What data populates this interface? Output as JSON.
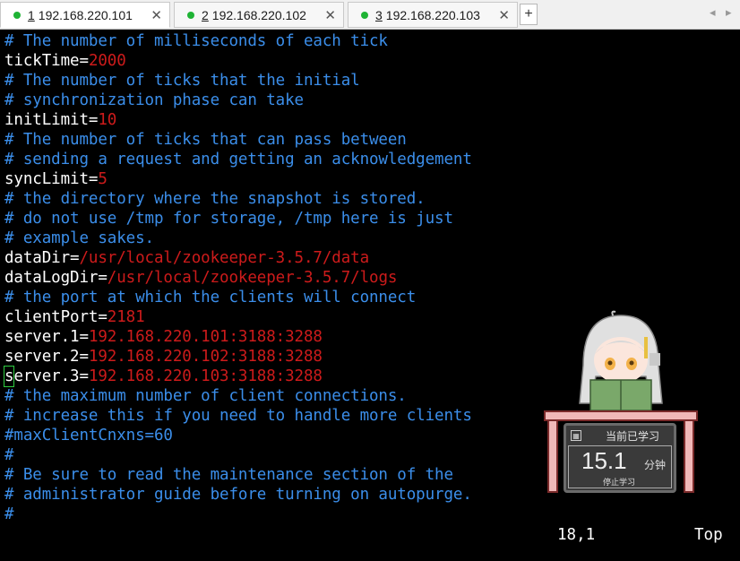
{
  "tabs": [
    {
      "number": "1",
      "label": " 192.168.220.101",
      "close": "✕"
    },
    {
      "number": "2",
      "label": " 192.168.220.102",
      "close": "✕"
    },
    {
      "number": "3",
      "label": " 192.168.220.103",
      "close": "✕"
    }
  ],
  "new_tab_label": "+",
  "nav": {
    "prev": "◂",
    "next": "▸"
  },
  "config_lines": [
    {
      "comment": "# The number of milliseconds of each tick"
    },
    {
      "key": "tickTime=",
      "value": "2000"
    },
    {
      "comment": "# The number of ticks that the initial"
    },
    {
      "comment": "# synchronization phase can take"
    },
    {
      "key": "initLimit=",
      "value": "10"
    },
    {
      "comment": "# The number of ticks that can pass between"
    },
    {
      "comment": "# sending a request and getting an acknowledgement"
    },
    {
      "key": "syncLimit=",
      "value": "5"
    },
    {
      "comment": "# the directory where the snapshot is stored."
    },
    {
      "comment": "# do not use /tmp for storage, /tmp here is just"
    },
    {
      "comment": "# example sakes."
    },
    {
      "key": "dataDir=",
      "value": "/usr/local/zookeeper-3.5.7/data"
    },
    {
      "key": "dataLogDir=",
      "value": "/usr/local/zookeeper-3.5.7/logs"
    },
    {
      "comment": "# the port at which the clients will connect"
    },
    {
      "key": "clientPort=",
      "value": "2181"
    },
    {
      "key": "server.1=",
      "value": "192.168.220.101:3188:3288"
    },
    {
      "key": "server.2=",
      "value": "192.168.220.102:3188:3288"
    },
    {
      "cursor_char": "s",
      "key": "erver.3=",
      "value": "192.168.220.103:3188:3288"
    },
    {
      "comment": "# the maximum number of client connections."
    },
    {
      "comment": "# increase this if you need to handle more clients"
    },
    {
      "comment": "#maxClientCnxns=60"
    },
    {
      "comment": "#"
    },
    {
      "comment": "# Be sure to read the maintenance section of the"
    },
    {
      "comment": "# administrator guide before turning on autopurge."
    },
    {
      "comment": "#"
    }
  ],
  "status": {
    "position": "18,1",
    "scroll": "Top"
  },
  "study_widget": {
    "title": "当前已学习",
    "minutes": "15.1",
    "unit": "分钟",
    "stop_label": "停止学习",
    "icon": "calculator-icon"
  },
  "colors": {
    "comment": "#3b8eea",
    "value": "#cd1b1b",
    "text": "#ffffff",
    "background": "#000000",
    "status_dot": "#1fb335"
  }
}
